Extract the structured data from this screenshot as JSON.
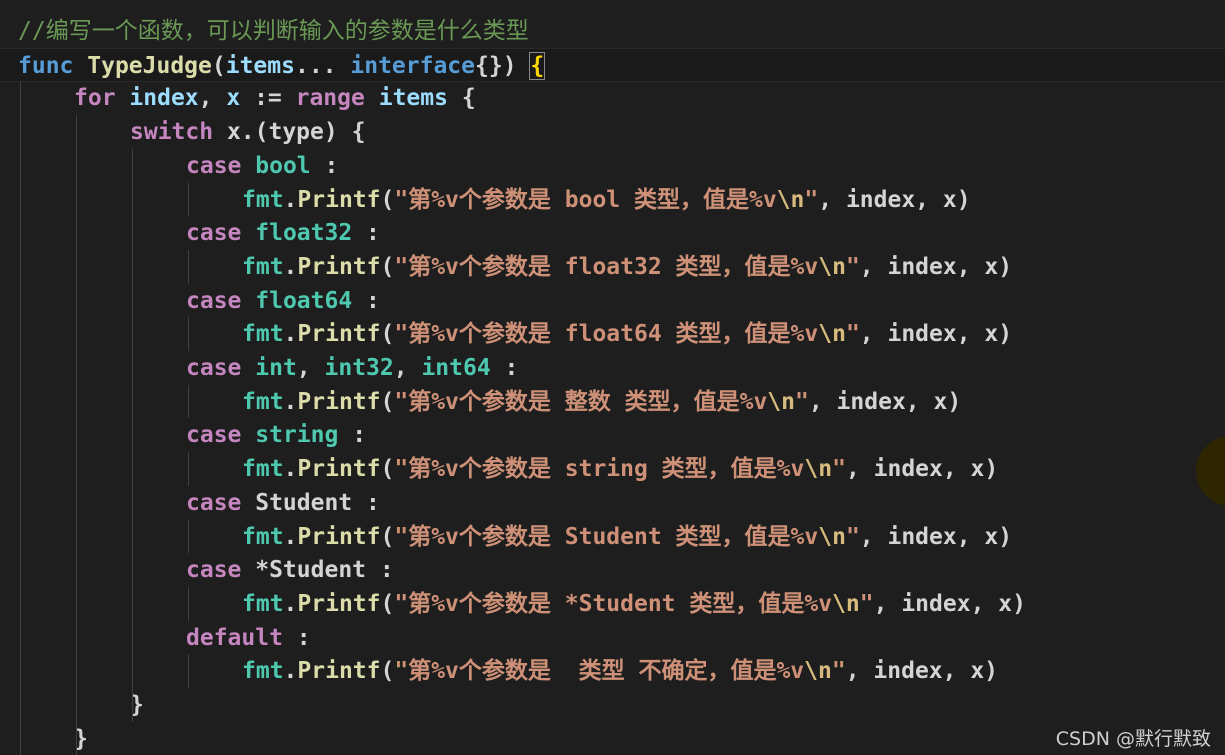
{
  "editor": {
    "theme_colors": {
      "background": "#1e1e1e",
      "comment": "#6a9955",
      "keyword": "#569cd6",
      "control": "#c586c0",
      "function": "#dcdcaa",
      "variable": "#9cdcfe",
      "type": "#4ec9b0",
      "string": "#ce9178",
      "escape": "#d7ba7d"
    },
    "lines": [
      {
        "indent": 0,
        "tokens": [
          {
            "t": "//编写一个函数，可以判断输入的参数是什么类型",
            "c": "comment"
          }
        ]
      },
      {
        "indent": 0,
        "current": true,
        "tokens": [
          {
            "t": "func",
            "c": "kw"
          },
          {
            "t": " "
          },
          {
            "t": "TypeJudge",
            "c": "fn"
          },
          {
            "t": "("
          },
          {
            "t": "items",
            "c": "var"
          },
          {
            "t": "... "
          },
          {
            "t": "interface",
            "c": "kw"
          },
          {
            "t": "{})"
          },
          {
            "t": " "
          },
          {
            "t": "{",
            "c": "bracket"
          }
        ]
      },
      {
        "indent": 1,
        "tokens": [
          {
            "t": "for",
            "c": "ctrl"
          },
          {
            "t": " "
          },
          {
            "t": "index",
            "c": "var"
          },
          {
            "t": ", "
          },
          {
            "t": "x",
            "c": "var"
          },
          {
            "t": " := "
          },
          {
            "t": "range",
            "c": "ctrl"
          },
          {
            "t": " "
          },
          {
            "t": "items",
            "c": "var"
          },
          {
            "t": " {"
          }
        ]
      },
      {
        "indent": 2,
        "tokens": [
          {
            "t": "switch",
            "c": "ctrl"
          },
          {
            "t": " x.(type) {"
          }
        ]
      },
      {
        "indent": 3,
        "tokens": [
          {
            "t": "case",
            "c": "ctrl"
          },
          {
            "t": " "
          },
          {
            "t": "bool",
            "c": "type"
          },
          {
            "t": " :"
          }
        ]
      },
      {
        "indent": 4,
        "tokens": [
          {
            "t": "fmt",
            "c": "type"
          },
          {
            "t": "."
          },
          {
            "t": "Printf",
            "c": "fn"
          },
          {
            "t": "("
          },
          {
            "t": "\"第%v个参数是 bool 类型，值是%v",
            "c": "str"
          },
          {
            "t": "\\n",
            "c": "esc"
          },
          {
            "t": "\"",
            "c": "str"
          },
          {
            "t": ", index, x)"
          }
        ]
      },
      {
        "indent": 3,
        "tokens": [
          {
            "t": "case",
            "c": "ctrl"
          },
          {
            "t": " "
          },
          {
            "t": "float32",
            "c": "type"
          },
          {
            "t": " :"
          }
        ]
      },
      {
        "indent": 4,
        "tokens": [
          {
            "t": "fmt",
            "c": "type"
          },
          {
            "t": "."
          },
          {
            "t": "Printf",
            "c": "fn"
          },
          {
            "t": "("
          },
          {
            "t": "\"第%v个参数是 float32 类型，值是%v",
            "c": "str"
          },
          {
            "t": "\\n",
            "c": "esc"
          },
          {
            "t": "\"",
            "c": "str"
          },
          {
            "t": ", index, x)"
          }
        ]
      },
      {
        "indent": 3,
        "tokens": [
          {
            "t": "case",
            "c": "ctrl"
          },
          {
            "t": " "
          },
          {
            "t": "float64",
            "c": "type"
          },
          {
            "t": " :"
          }
        ]
      },
      {
        "indent": 4,
        "tokens": [
          {
            "t": "fmt",
            "c": "type"
          },
          {
            "t": "."
          },
          {
            "t": "Printf",
            "c": "fn"
          },
          {
            "t": "("
          },
          {
            "t": "\"第%v个参数是 float64 类型，值是%v",
            "c": "str"
          },
          {
            "t": "\\n",
            "c": "esc"
          },
          {
            "t": "\"",
            "c": "str"
          },
          {
            "t": ", index, x)"
          }
        ]
      },
      {
        "indent": 3,
        "tokens": [
          {
            "t": "case",
            "c": "ctrl"
          },
          {
            "t": " "
          },
          {
            "t": "int",
            "c": "type"
          },
          {
            "t": ", "
          },
          {
            "t": "int32",
            "c": "type"
          },
          {
            "t": ", "
          },
          {
            "t": "int64",
            "c": "type"
          },
          {
            "t": " :"
          }
        ]
      },
      {
        "indent": 4,
        "tokens": [
          {
            "t": "fmt",
            "c": "type"
          },
          {
            "t": "."
          },
          {
            "t": "Printf",
            "c": "fn"
          },
          {
            "t": "("
          },
          {
            "t": "\"第%v个参数是 整数 类型，值是%v",
            "c": "str"
          },
          {
            "t": "\\n",
            "c": "esc"
          },
          {
            "t": "\"",
            "c": "str"
          },
          {
            "t": ", index, x)"
          }
        ]
      },
      {
        "indent": 3,
        "tokens": [
          {
            "t": "case",
            "c": "ctrl"
          },
          {
            "t": " "
          },
          {
            "t": "string",
            "c": "type"
          },
          {
            "t": " :"
          }
        ]
      },
      {
        "indent": 4,
        "tokens": [
          {
            "t": "fmt",
            "c": "type"
          },
          {
            "t": "."
          },
          {
            "t": "Printf",
            "c": "fn"
          },
          {
            "t": "("
          },
          {
            "t": "\"第%v个参数是 string 类型，值是%v",
            "c": "str"
          },
          {
            "t": "\\n",
            "c": "esc"
          },
          {
            "t": "\"",
            "c": "str"
          },
          {
            "t": ", index, x)"
          }
        ]
      },
      {
        "indent": 3,
        "tokens": [
          {
            "t": "case",
            "c": "ctrl"
          },
          {
            "t": " Student :"
          }
        ]
      },
      {
        "indent": 4,
        "tokens": [
          {
            "t": "fmt",
            "c": "type"
          },
          {
            "t": "."
          },
          {
            "t": "Printf",
            "c": "fn"
          },
          {
            "t": "("
          },
          {
            "t": "\"第%v个参数是 Student 类型，值是%v",
            "c": "str"
          },
          {
            "t": "\\n",
            "c": "esc"
          },
          {
            "t": "\"",
            "c": "str"
          },
          {
            "t": ", index, x)"
          }
        ]
      },
      {
        "indent": 3,
        "tokens": [
          {
            "t": "case",
            "c": "ctrl"
          },
          {
            "t": " *Student :"
          }
        ]
      },
      {
        "indent": 4,
        "tokens": [
          {
            "t": "fmt",
            "c": "type"
          },
          {
            "t": "."
          },
          {
            "t": "Printf",
            "c": "fn"
          },
          {
            "t": "("
          },
          {
            "t": "\"第%v个参数是 *Student 类型，值是%v",
            "c": "str"
          },
          {
            "t": "\\n",
            "c": "esc"
          },
          {
            "t": "\"",
            "c": "str"
          },
          {
            "t": ", index, x)"
          }
        ]
      },
      {
        "indent": 3,
        "tokens": [
          {
            "t": "default",
            "c": "ctrl"
          },
          {
            "t": " :"
          }
        ]
      },
      {
        "indent": 4,
        "tokens": [
          {
            "t": "fmt",
            "c": "type"
          },
          {
            "t": "."
          },
          {
            "t": "Printf",
            "c": "fn"
          },
          {
            "t": "("
          },
          {
            "t": "\"第%v个参数是  类型 不确定，值是%v",
            "c": "str"
          },
          {
            "t": "\\n",
            "c": "esc"
          },
          {
            "t": "\"",
            "c": "str"
          },
          {
            "t": ", index, x)"
          }
        ]
      },
      {
        "indent": 2,
        "tokens": [
          {
            "t": "}"
          }
        ]
      },
      {
        "indent": 1,
        "tokens": [
          {
            "t": "}"
          }
        ]
      }
    ]
  },
  "watermark": "CSDN @默行默致"
}
